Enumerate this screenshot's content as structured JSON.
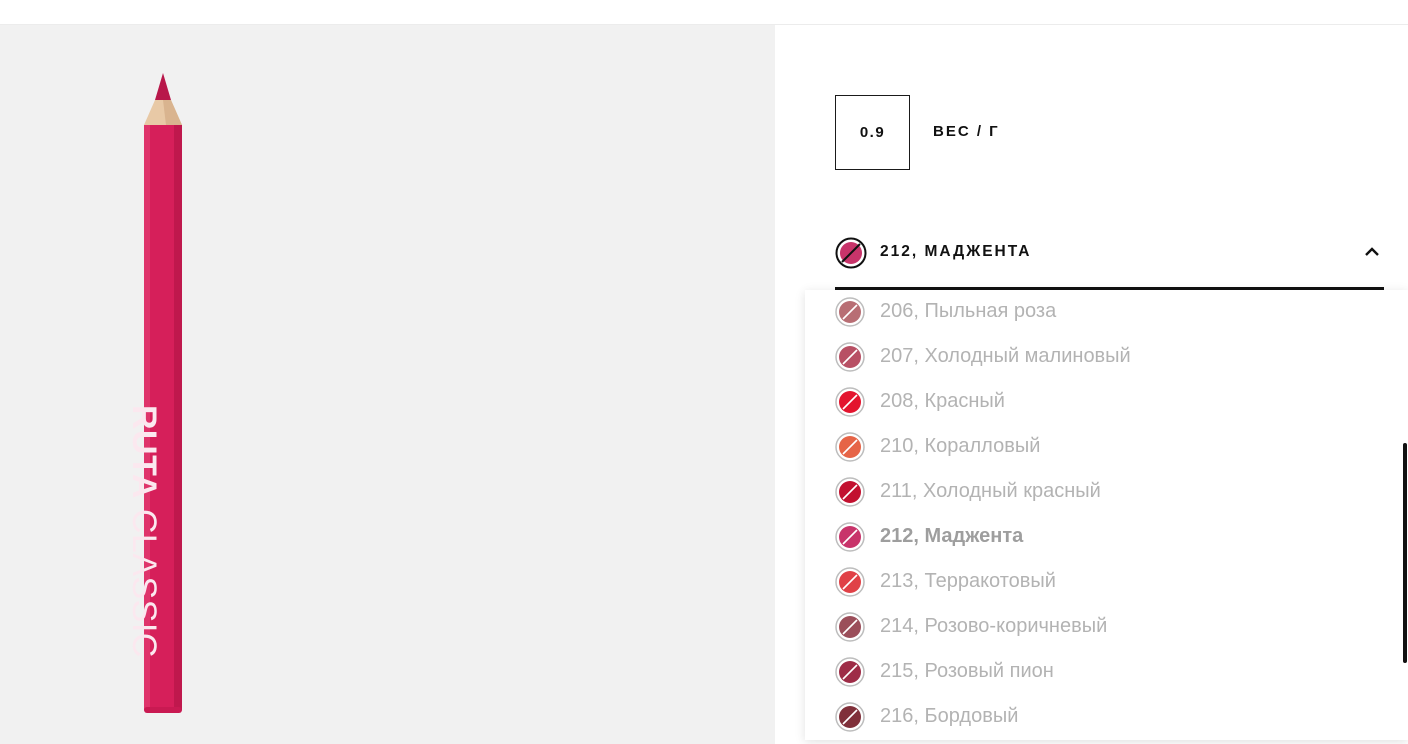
{
  "product": {
    "brand_text_bold": "RUTA",
    "brand_text_light": "CLASSIC",
    "pencil_color": "#d61f5a"
  },
  "weight": {
    "value": "0.9",
    "label": "ВЕС / Г"
  },
  "shade_selector": {
    "selected_label": "212, МАДЖЕНТА",
    "selected_color": "#c8346a",
    "expanded": true
  },
  "shades": [
    {
      "label": "206, Пыльная роза",
      "color": "#b86e74",
      "selected": false
    },
    {
      "label": "207, Холодный малиновый",
      "color": "#b85064",
      "selected": false
    },
    {
      "label": "208, Красный",
      "color": "#e3142e",
      "selected": false
    },
    {
      "label": "210, Коралловый",
      "color": "#e66447",
      "selected": false
    },
    {
      "label": "211, Холодный красный",
      "color": "#c2102f",
      "selected": false
    },
    {
      "label": "212, Маджента",
      "color": "#c8346a",
      "selected": true
    },
    {
      "label": "213, Терракотовый",
      "color": "#e04147",
      "selected": false
    },
    {
      "label": "214, Розово-коричневый",
      "color": "#9b4e5a",
      "selected": false
    },
    {
      "label": "215, Розовый пион",
      "color": "#9e2c47",
      "selected": false
    },
    {
      "label": "216, Бордовый",
      "color": "#80303a",
      "selected": false
    }
  ],
  "colors": {
    "gallery_bg": "#f1f1f1",
    "text_dark": "#111111",
    "option_text": "#b3b3b3"
  }
}
